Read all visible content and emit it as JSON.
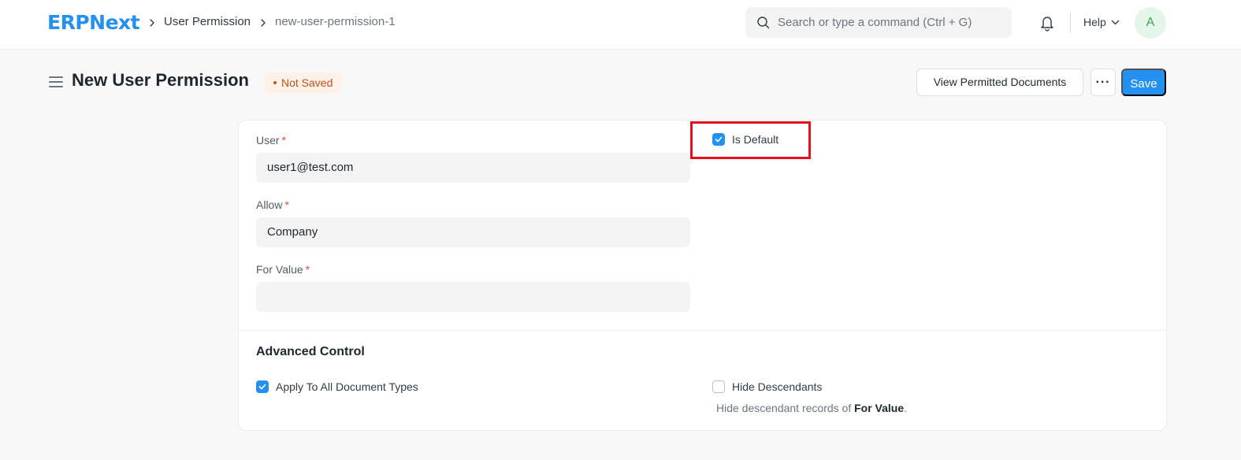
{
  "navbar": {
    "logo_text": "ERPNext",
    "breadcrumbs": [
      "User Permission",
      "new-user-permission-1"
    ],
    "search_placeholder": "Search or type a command (Ctrl + G)",
    "help_label": "Help",
    "avatar_initial": "A"
  },
  "page_head": {
    "title": "New User Permission",
    "status": "Not Saved",
    "view_permitted_label": "View Permitted Documents",
    "more_label": "···",
    "save_label": "Save"
  },
  "form": {
    "user": {
      "label": "User",
      "required_mark": "*",
      "value": "user1@test.com"
    },
    "allow": {
      "label": "Allow",
      "required_mark": "*",
      "value": "Company"
    },
    "for_value": {
      "label": "For Value",
      "required_mark": "*",
      "value": ""
    },
    "is_default": {
      "label": "Is Default",
      "checked": true
    },
    "advanced_section_title": "Advanced Control",
    "apply_to_all": {
      "label": "Apply To All Document Types",
      "checked": true
    },
    "hide_descendants": {
      "label": "Hide Descendants",
      "checked": false
    },
    "hide_descendants_help_prefix": "Hide descendant records of ",
    "hide_descendants_help_field": "For Value",
    "hide_descendants_help_suffix": "."
  },
  "colors": {
    "primary": "#2490ef",
    "highlight": "#e8101a",
    "not_saved": "#c0521f"
  }
}
